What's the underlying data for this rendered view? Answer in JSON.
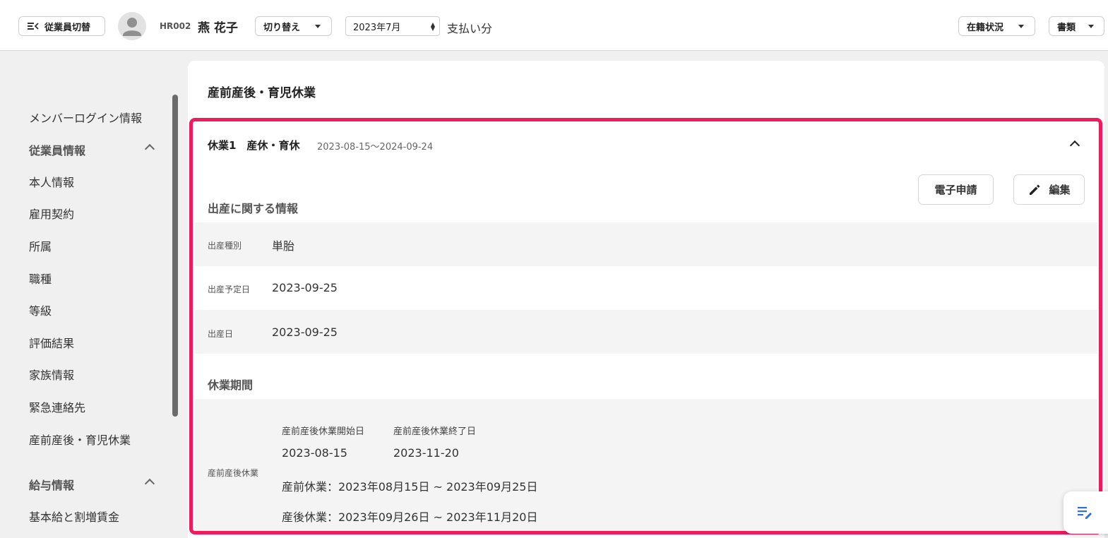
{
  "header": {
    "employee_switch_label": "従業員切替",
    "employee_code": "HR002",
    "employee_name": "燕 花子",
    "switch_label": "切り替え",
    "month_value": "2023年7月",
    "payment_label": "支払い分",
    "status_label": "在籍状況",
    "documents_label": "書類"
  },
  "sidebar": {
    "items": [
      {
        "label": "メンバーログイン情報",
        "type": "item"
      },
      {
        "label": "従業員情報",
        "type": "heading"
      },
      {
        "label": "本人情報",
        "type": "item"
      },
      {
        "label": "雇用契約",
        "type": "item"
      },
      {
        "label": "所属",
        "type": "item"
      },
      {
        "label": "職種",
        "type": "item"
      },
      {
        "label": "等級",
        "type": "item"
      },
      {
        "label": "評価結果",
        "type": "item"
      },
      {
        "label": "家族情報",
        "type": "item"
      },
      {
        "label": "緊急連絡先",
        "type": "item"
      },
      {
        "label": "産前産後・育児休業",
        "type": "item"
      },
      {
        "label": "給与情報",
        "type": "heading"
      },
      {
        "label": "基本給と割増賃金",
        "type": "item"
      }
    ]
  },
  "main": {
    "title": "産前産後・育児休業",
    "leave": {
      "number_label": "休業1　産休・育休",
      "range": "2023-08-15〜2024-09-24",
      "e_apply_label": "電子申請",
      "edit_label": "編集",
      "birth_section_title": "出産に関する情報",
      "birth_rows": [
        {
          "label": "出産種別",
          "value": "単胎"
        },
        {
          "label": "出産予定日",
          "value": "2023-09-25"
        },
        {
          "label": "出産日",
          "value": "2023-09-25"
        }
      ],
      "period_section_title": "休業期間",
      "maternity_label": "産前産後休業",
      "start_header": "産前産後休業開始日",
      "end_header": "産前産後休業終了日",
      "start_value": "2023-08-15",
      "end_value": "2023-11-20",
      "prenatal_line": "産前休業：2023年08月15日 ~ 2023年09月25日",
      "postnatal_line": "産後休業：2023年09月26日 ~ 2023年11月20日"
    }
  },
  "colors": {
    "highlight": "#f01a5c",
    "accent_icon": "#2f6fd6"
  },
  "icons": [
    "menu-collapse-icon",
    "avatar-person-icon",
    "chevron-down-icon",
    "chevron-up-icon",
    "pencil-icon",
    "notes-edit-icon"
  ]
}
